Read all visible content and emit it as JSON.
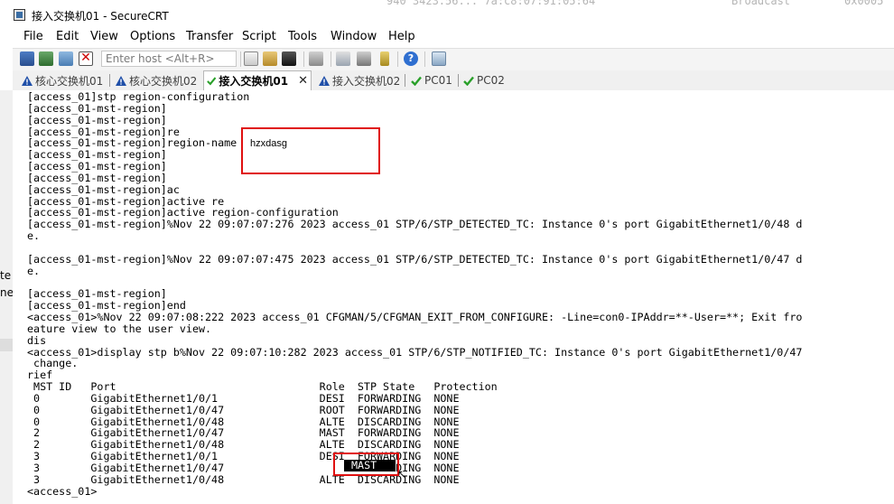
{
  "window": {
    "title": "接入交换机01 - SecureCRT",
    "background_ghost": [
      "940 3423.56...  7a:c8:07:91:05:64",
      "Broadcast",
      "0x0005"
    ]
  },
  "menu": [
    "File",
    "Edit",
    "View",
    "Options",
    "Transfer",
    "Script",
    "Tools",
    "Window",
    "Help"
  ],
  "toolbar": {
    "icons": [
      "connect-icon",
      "quick-connect-icon",
      "reconnect-icon",
      "disconnect-icon",
      "copy-icon",
      "paste-icon",
      "find-icon",
      "print-icon",
      "session-options-icon",
      "global-options-icon",
      "keymap-icon",
      "help-icon",
      "sftp-icon"
    ],
    "host_placeholder": "Enter host <Alt+R>"
  },
  "tabs": [
    {
      "label": "核心交换机01",
      "status": "warning"
    },
    {
      "label": "核心交换机02",
      "status": "warning"
    },
    {
      "label": "接入交换机01",
      "status": "connected",
      "active": true
    },
    {
      "label": "接入交换机02",
      "status": "warning"
    },
    {
      "label": "PC01",
      "status": "connected"
    },
    {
      "label": "PC02",
      "status": "connected"
    }
  ],
  "colors": {
    "annotation": "#e01010",
    "warning": "#1f4fa8",
    "connected": "#2aa02a"
  },
  "gutter_text": [
    "te",
    "ne"
  ],
  "overlay_text": "hzxdasg",
  "terminal_lines": [
    "[access_01]stp region-configuration",
    "[access_01-mst-region]",
    "[access_01-mst-region]",
    "[access_01-mst-region]re",
    "[access_01-mst-region]region-name",
    "[access_01-mst-region]",
    "[access_01-mst-region]",
    "[access_01-mst-region]",
    "[access_01-mst-region]ac",
    "[access_01-mst-region]active re",
    "[access_01-mst-region]active region-configuration",
    "[access_01-mst-region]%Nov 22 09:07:07:276 2023 access_01 STP/6/STP_DETECTED_TC: Instance 0's port GigabitEthernet1/0/48 d",
    "e.",
    "",
    "[access_01-mst-region]%Nov 22 09:07:07:475 2023 access_01 STP/6/STP_DETECTED_TC: Instance 0's port GigabitEthernet1/0/47 d",
    "e.",
    "",
    "[access_01-mst-region]",
    "[access_01-mst-region]end",
    "<access_01>%Nov 22 09:07:08:222 2023 access_01 CFGMAN/5/CFGMAN_EXIT_FROM_CONFIGURE: -Line=con0-IPAddr=**-User=**; Exit fro",
    "eature view to the user view.",
    "dis",
    "<access_01>display stp b%Nov 22 09:07:10:282 2023 access_01 STP/6/STP_NOTIFIED_TC: Instance 0's port GigabitEthernet1/0/47",
    " change.",
    "rief",
    " MST ID   Port                                Role  STP State   Protection",
    " 0        GigabitEthernet1/0/1                DESI  FORWARDING  NONE",
    " 0        GigabitEthernet1/0/47               ROOT  FORWARDING  NONE",
    " 0        GigabitEthernet1/0/48               ALTE  DISCARDING  NONE",
    " 2        GigabitEthernet1/0/47               MAST  FORWARDING  NONE",
    " 2        GigabitEthernet1/0/48               ALTE  DISCARDING  NONE",
    " 3        GigabitEthernet1/0/1                DESI  FORWARDING  NONE",
    " 3        GigabitEthernet1/0/47                     FORWARDING  NONE",
    " 3        GigabitEthernet1/0/48               ALTE  DISCARDING  NONE",
    "<access_01>"
  ],
  "highlighted_role": "MAST"
}
